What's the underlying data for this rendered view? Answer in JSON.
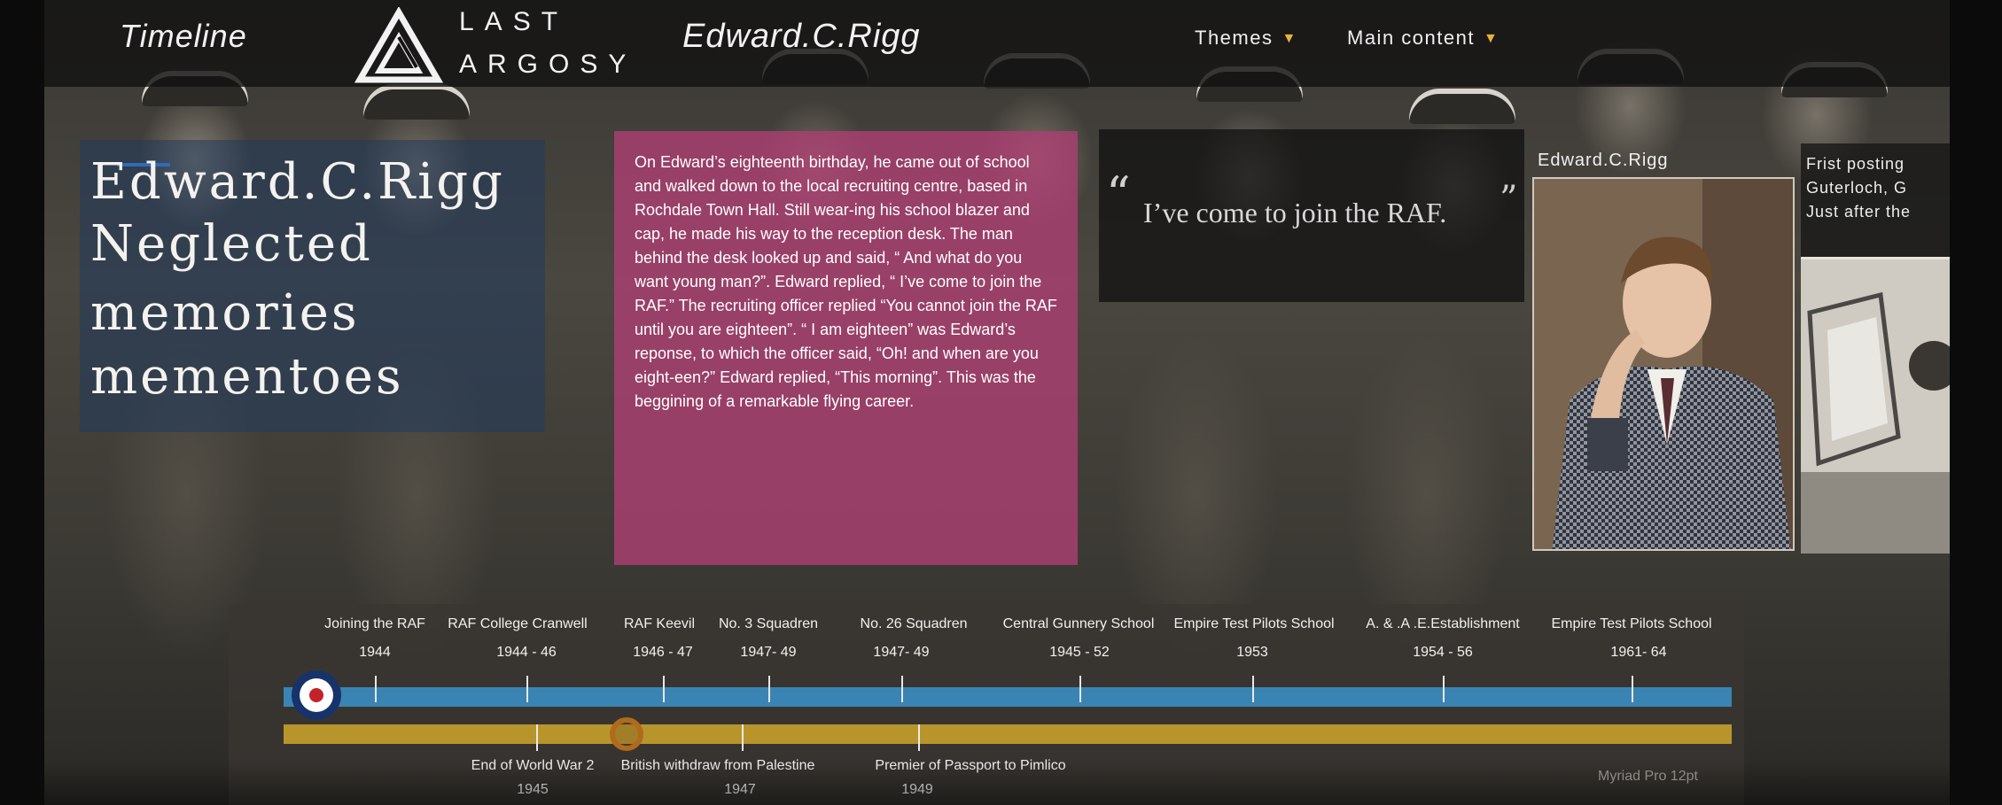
{
  "nav": {
    "timeline_label": "Timeline",
    "logo_line1": "LAST",
    "logo_line2": "ARGOSY",
    "person_name": "Edward.C.Rigg",
    "themes_label": "Themes",
    "main_content_label": "Main content"
  },
  "hero": {
    "title_lines": [
      "Edward.C.Rigg",
      "Neglected",
      "memories",
      "mementoes"
    ]
  },
  "story": {
    "text": "On Edward’s eighteenth birthday, he came out of school and walked down to the local recruiting centre, based in Rochdale Town Hall. Still wear-ing his school blazer and cap, he made his way to the reception desk. The man behind the desk looked up and said, “ And what do you want young man?”. Edward replied, “ I’ve come to join the RAF.” The recruiting officer replied “You cannot join the RAF until you are eighteen”. “ I am eighteen” was Edward’s reponse, to which the officer said, “Oh! and when are you eight-een?” Edward replied, “This morning”. This was the beggining of a remarkable flying career."
  },
  "quote": {
    "open_mark": "“",
    "text": "I’ve come to join the RAF.",
    "close_mark": "”"
  },
  "portrait_card": {
    "label": "Edward.C.Rigg"
  },
  "second_card": {
    "text": "Frist posting\nGuterloch, G\nJust after the"
  },
  "timeline": {
    "career_events": [
      {
        "label": "Joining the RAF",
        "years": "1944"
      },
      {
        "label": "RAF College Cranwell",
        "years": "1944 - 46"
      },
      {
        "label": "RAF Keevil",
        "years": "1946 - 47"
      },
      {
        "label": "No. 3 Squadren",
        "years": "1947- 49"
      },
      {
        "label": "No. 26 Squadren",
        "years": "1947- 49"
      },
      {
        "label": "Central Gunnery School",
        "years": "1945 - 52"
      },
      {
        "label": "Empire Test Pilots School",
        "years": "1953"
      },
      {
        "label": "A. & .A .E.Establishment",
        "years": "1954 - 56"
      },
      {
        "label": "Empire Test Pilots School",
        "years": "1961- 64"
      }
    ],
    "world_events": [
      {
        "label": "End of World War 2",
        "year": "1945"
      },
      {
        "label": "British withdraw from Palestine",
        "year": "1947"
      },
      {
        "label": "Premier of Passport to Pimlico",
        "year": "1949"
      }
    ],
    "career_color": "#3a84b4",
    "world_color": "#b8952a",
    "roundel_icon": "raf-roundel-icon",
    "font_note": "Myriad Pro 12pt"
  }
}
